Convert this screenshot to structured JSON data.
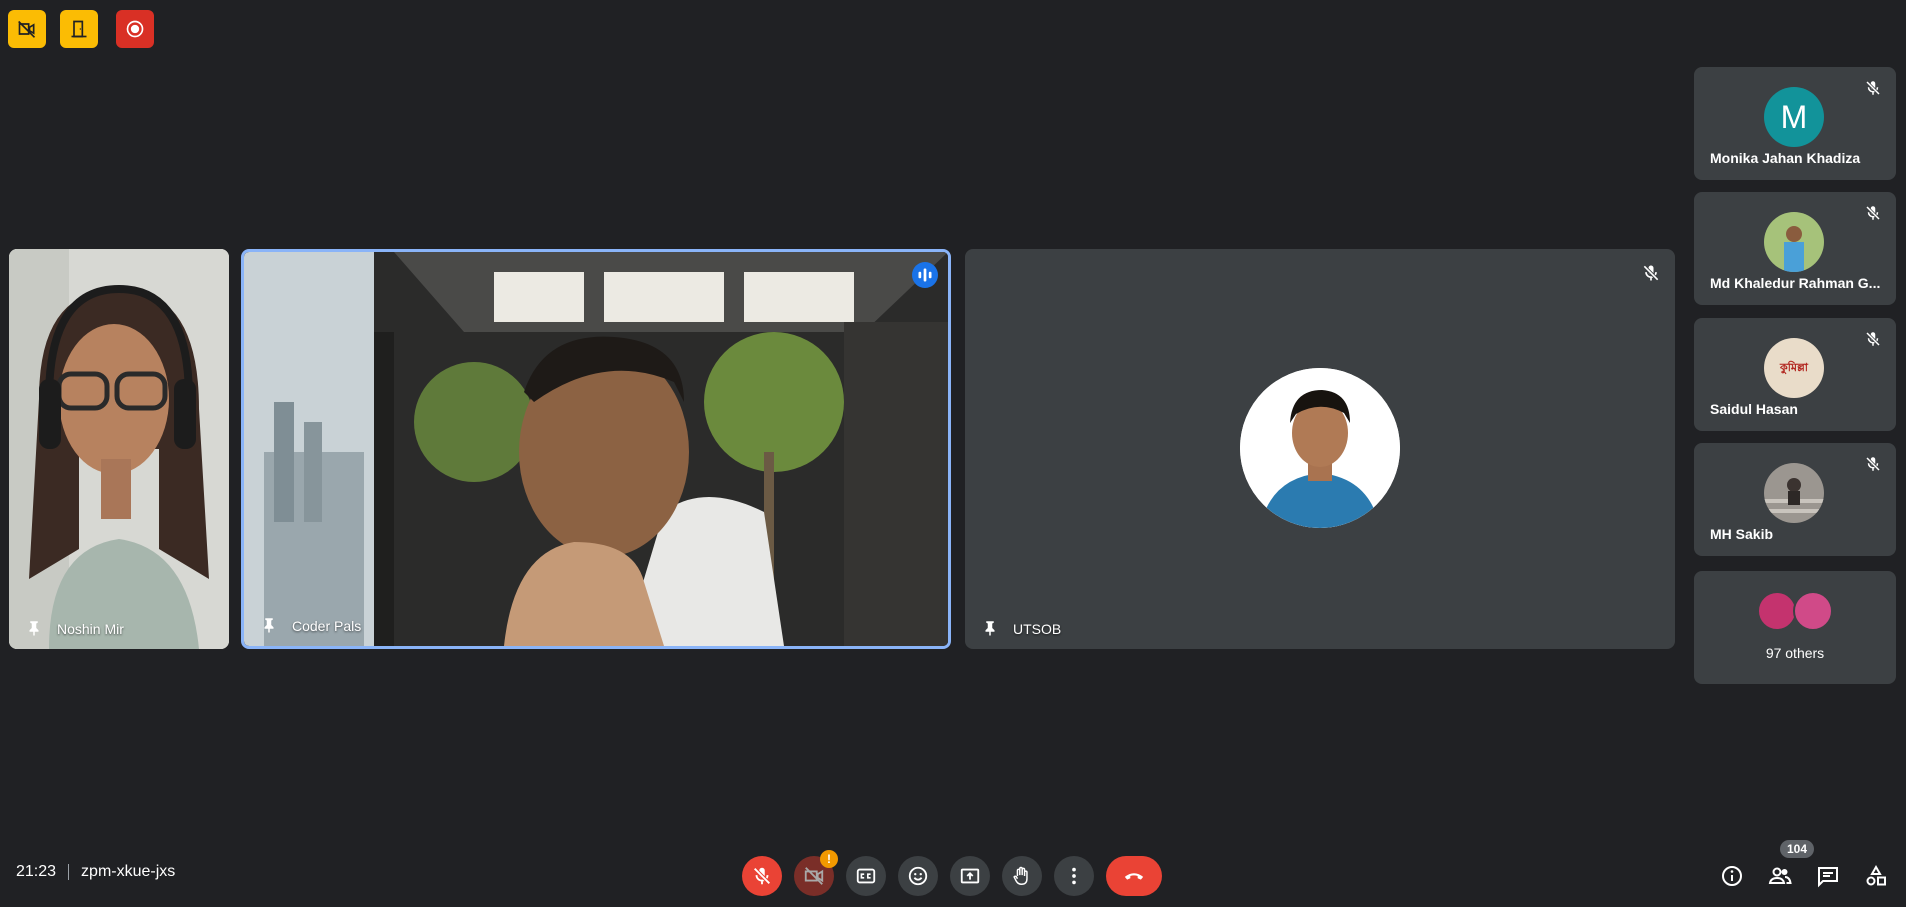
{
  "top_bar": {
    "buttons": [
      {
        "name": "camera-off-indicator",
        "color": "#fbbc04"
      },
      {
        "name": "leave-room-indicator",
        "color": "#fbbc04"
      },
      {
        "name": "recording-indicator",
        "color": "#d93025"
      }
    ]
  },
  "main_tiles": [
    {
      "name": "Noshin Mir"
    },
    {
      "name": "Coder Pals",
      "speaking": true
    },
    {
      "name": "UTSOB",
      "muted": true
    }
  ],
  "sidebar": {
    "participants": [
      {
        "name": "Monika Jahan Khadiza",
        "avatar_letter": "M",
        "avatar_color": "#12939a",
        "muted": true
      },
      {
        "name": "Md Khaledur Rahman G...",
        "muted": true
      },
      {
        "name": "Saidul Hasan",
        "avatar_text": "কুমিল্লা",
        "muted": true
      },
      {
        "name": "MH Sakib",
        "muted": true
      }
    ],
    "others_label": "97 others"
  },
  "bottom_bar": {
    "time": "21:23",
    "meeting_code": "zpm-xkue-jxs",
    "participant_count": "104",
    "camera_alert_badge": "!",
    "controls": [
      "mic-muted",
      "camera-off",
      "captions",
      "emoji",
      "present",
      "raise-hand",
      "more-options"
    ],
    "accent_red": "#ea4335"
  }
}
